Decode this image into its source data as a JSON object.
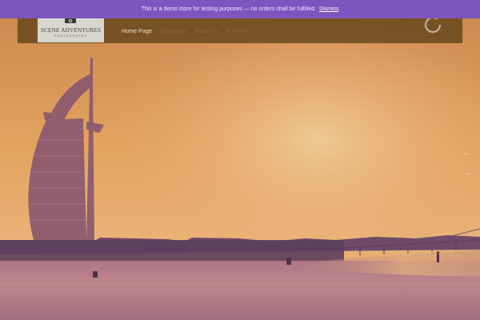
{
  "demo_notice": {
    "text": "This is a demo store for testing purposes — no orders shall be fulfilled.",
    "dismiss_label": "Dismiss"
  },
  "header": {
    "logo_name": "SCENE ADVENTURES",
    "logo_tagline": "PHOTOGRAPHY"
  },
  "nav": {
    "items": [
      {
        "label": "Home Page"
      },
      {
        "label": "Slideshow"
      },
      {
        "label": "About Us"
      },
      {
        "label": "Portfolio"
      }
    ]
  },
  "slider": {
    "prev_label": "←",
    "next_label": "→"
  },
  "icons": {
    "camera": "camera-icon",
    "loader": "loading-spinner-icon",
    "prev": "arrow-left-icon",
    "next": "arrow-right-icon"
  },
  "colors": {
    "demo_bar": "#7e55be",
    "header_overlay": "#553c14",
    "sky_top": "#d08e49",
    "sky_glow": "#f8cf8a",
    "ground": "#c98a80"
  }
}
